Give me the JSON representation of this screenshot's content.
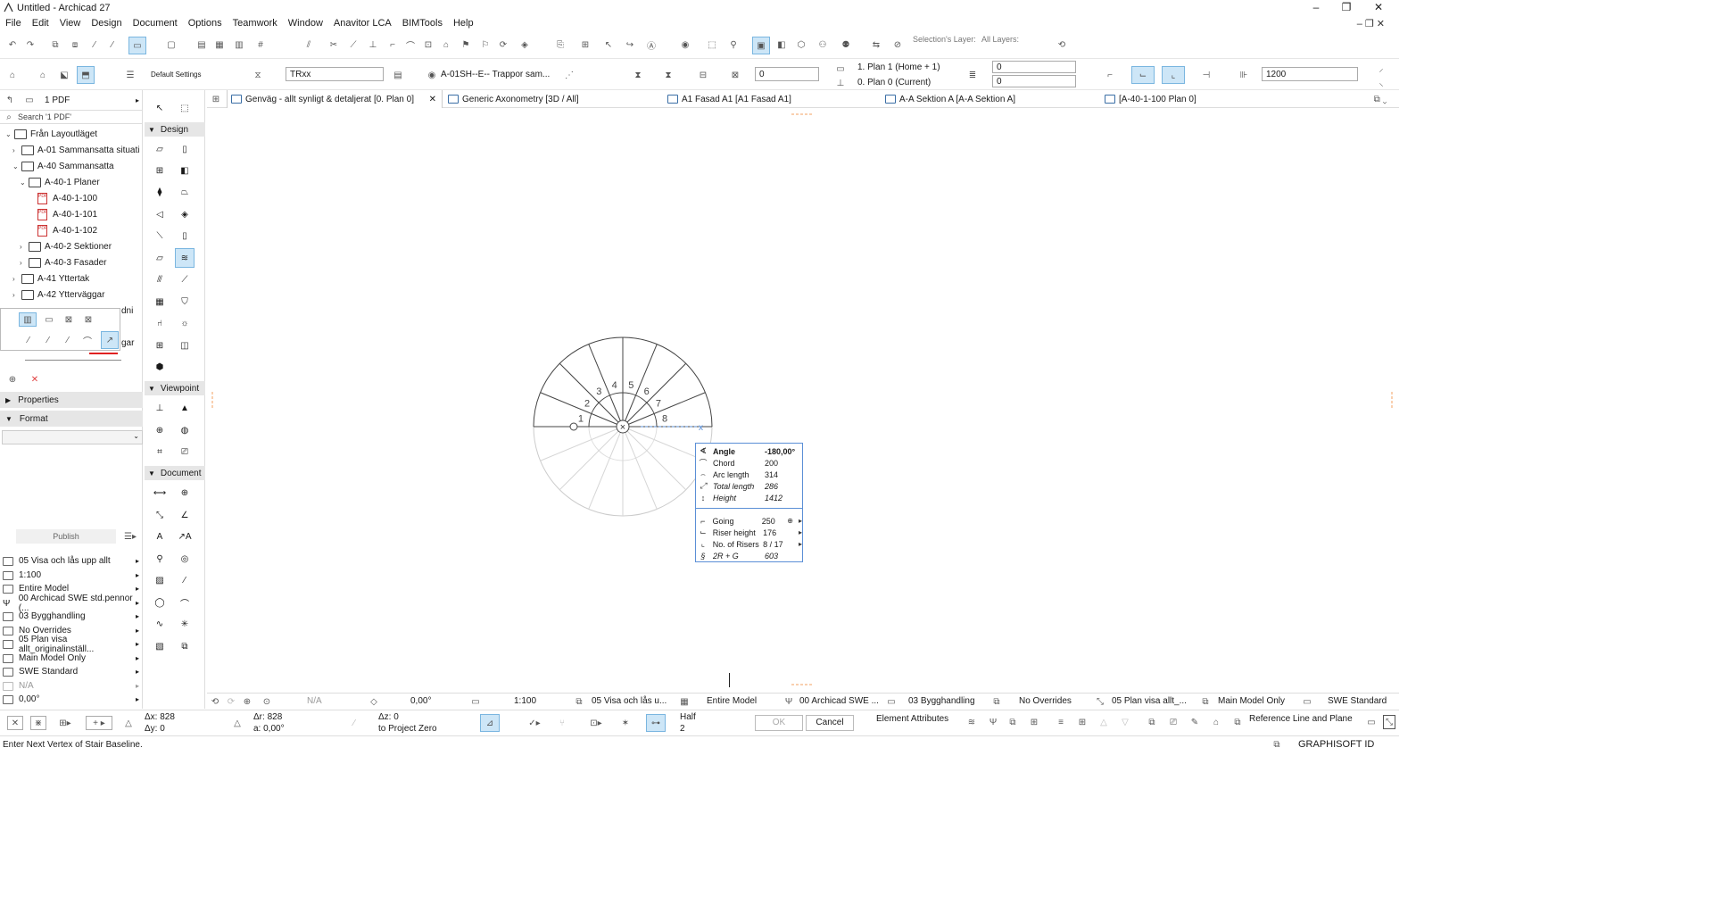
{
  "window": {
    "title": "Untitled - Archicad 27",
    "minimize": "–",
    "maximize": "❐",
    "close": "✕",
    "menu_right": "– ❐ ✕"
  },
  "menu": [
    "File",
    "Edit",
    "View",
    "Design",
    "Document",
    "Options",
    "Teamwork",
    "Window",
    "Anavitor LCA",
    "BIMTools",
    "Help"
  ],
  "toolbar1": {
    "selection_layer_label": "Selection's Layer:",
    "all_layers_label": "All Layers:"
  },
  "toolbar2": {
    "default_settings": "Default Settings",
    "stair_name": "TRxx",
    "layer": "A-01SH--E-- Trappor sam...",
    "offset_value": "0",
    "home_story": "1. Plan 1 (Home + 1)",
    "current_story": "0. Plan 0 (Current)",
    "top_offset": "0",
    "bottom_offset": "0",
    "width_value": "1200"
  },
  "navigator": {
    "set_name": "1 PDF",
    "search_placeholder": "Search '1 PDF'",
    "items": [
      {
        "label": "Från Layoutläget",
        "type": "root"
      },
      {
        "label": "A-01 Sammansatta situati",
        "type": "folder"
      },
      {
        "label": "A-40 Sammansatta",
        "type": "folder"
      },
      {
        "label": "A-40-1 Planer",
        "type": "folder"
      },
      {
        "label": "A-40-1-100",
        "type": "pdf"
      },
      {
        "label": "A-40-1-101",
        "type": "pdf"
      },
      {
        "label": "A-40-1-102",
        "type": "pdf"
      },
      {
        "label": "A-40-2 Sektioner",
        "type": "folder"
      },
      {
        "label": "A-40-3 Fasader",
        "type": "folder"
      },
      {
        "label": "A-41 Yttertak",
        "type": "folder"
      },
      {
        "label": "A-42 Ytterväggar",
        "type": "folder"
      }
    ],
    "clipped_text_1": "dni",
    "clipped_text_2": "gar",
    "properties": "Properties",
    "format": "Format",
    "publish": "Publish"
  },
  "quick_options": [
    "05 Visa och lås upp allt",
    "1:100",
    "Entire Model",
    "00 Archicad SWE std.pennor (...",
    "03 Bygghandling",
    "No Overrides",
    "05 Plan visa allt_originalinställ...",
    "Main Model Only",
    "SWE Standard",
    "N/A",
    "0,00°"
  ],
  "toolbox": {
    "design": "Design",
    "viewpoint": "Viewpoint",
    "document": "Document"
  },
  "tabs": [
    {
      "label": "Genväg - allt synligt & detaljerat [0. Plan 0]",
      "active": true
    },
    {
      "label": "Generic Axonometry [3D / All]"
    },
    {
      "label": "A1 Fasad A1 [A1 Fasad A1]"
    },
    {
      "label": "A-A Sektion A [A-A Sektion A]"
    },
    {
      "label": "[A-40-1-100 Plan 0]"
    }
  ],
  "stair": {
    "riser_numbers": [
      "1",
      "2",
      "3",
      "4",
      "5",
      "6",
      "7",
      "8"
    ],
    "axis_label": "x",
    "center_symbol": "×"
  },
  "tracker": {
    "rows": [
      {
        "icon": "angle-icon",
        "label": "Angle",
        "value": "-180,00°",
        "bold": true
      },
      {
        "icon": "chord-icon",
        "label": "Chord",
        "value": "200"
      },
      {
        "icon": "arc-length-icon",
        "label": "Arc length",
        "value": "314"
      },
      {
        "icon": "total-length-icon",
        "label": "Total length",
        "value": "286",
        "italic": true
      },
      {
        "icon": "height-icon",
        "label": "Height",
        "value": "1412",
        "italic": true
      }
    ],
    "rows2": [
      {
        "icon": "going-icon",
        "label": "Going",
        "value": "250",
        "lock": true,
        "arrow": true
      },
      {
        "icon": "riser-height-icon",
        "label": "Riser height",
        "value": "176",
        "arrow": true
      },
      {
        "icon": "risers-icon",
        "label": "No. of Risers",
        "value": "8 / 17",
        "arrow": true
      },
      {
        "icon": "formula-icon",
        "label": "2R + G",
        "value": "603",
        "italic": true
      }
    ]
  },
  "viewbar": {
    "zoom": "N/A",
    "angle": "0,00°",
    "scale": "1:100",
    "layer_combo": "05 Visa och lås u...",
    "model": "Entire Model",
    "pen_set": "00 Archicad SWE ...",
    "mvo": "03 Bygghandling",
    "overrides": "No Overrides",
    "dim": "05 Plan visa allt_...",
    "structure": "Main Model Only",
    "standard": "SWE Standard"
  },
  "infobox": {
    "dx": "Δx: 828",
    "dy": "Δy: 0",
    "dr": "Δr: 828",
    "da": "a: 0,00°",
    "dz": "Δz: 0",
    "to_project_zero": "to Project Zero",
    "half": "Half",
    "half_num": "2",
    "ok": "OK",
    "cancel": "Cancel",
    "element_attributes": "Element Attributes",
    "reference_line": "Reference Line and Plane"
  },
  "status": {
    "message": "Enter Next Vertex of Stair Baseline.",
    "graphisoft": "GRAPHISOFT ID"
  },
  "colors": {
    "accent": "#5b8fd6",
    "selection": "#cde6f7",
    "pdf_red": "#c33333",
    "underline_red": "#e02020"
  }
}
